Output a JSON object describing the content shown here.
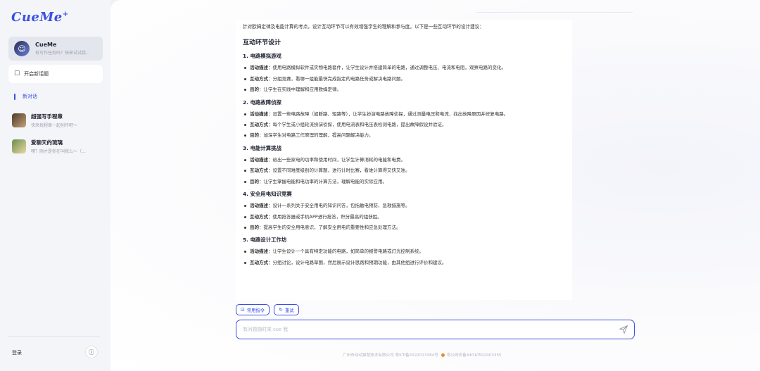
{
  "app": {
    "logo": "CueMe",
    "logo_mark": "+"
  },
  "sidebar": {
    "agent": {
      "name": "CueMe",
      "subtitle": "有写作任务吗？快来试试我..."
    },
    "new_topic_label": "开启新话题",
    "new_chat_label": "新对话",
    "conversations": [
      {
        "name": "超强写手程章",
        "subtitle": "快来找程章一起创作吧～"
      },
      {
        "name": "爱聊天的琉璃",
        "subtitle": "嘿？刚才是你在叫我么～（..."
      }
    ],
    "login_label": "登录",
    "info_icon": "ⓘ"
  },
  "answer": {
    "intro": "针对欧姆定律及电能计算的考点，设计互动环节可以有效增强学生的理解和参与度。以下是一些互动环节的设计建议：",
    "heading": "互动环节设计",
    "sections": [
      {
        "title": "1. 电路模拟游戏",
        "items": [
          {
            "label": "活动描述",
            "text": "：使用电路模拟软件或实物电路套件，让学生设计并搭建简单的电路，通过调整电压、电流和电阻，观察电路的变化。"
          },
          {
            "label": "互动方式",
            "text": "：分组竞赛，看哪一组能最快完成指定的电路任务或解决电路问题。"
          },
          {
            "label": "目的",
            "text": "：让学生在实践中理解和应用欧姆定律。"
          }
        ]
      },
      {
        "title": "2. 电路故障侦探",
        "items": [
          {
            "label": "活动描述",
            "text": "：设置一些电路故障（如断路、短路等），让学生扮演电路故障侦探，通过测量电压和电流，找出故障原因并修复电路。"
          },
          {
            "label": "互动方式",
            "text": "：每个学生或小组轮流扮演侦探，使用电流表和电压表检测电路，提出故障假设并验证。"
          },
          {
            "label": "目的",
            "text": "：加深学生对电路工作原理的理解，提高问题解决能力。"
          }
        ]
      },
      {
        "title": "3. 电能计算挑战",
        "items": [
          {
            "label": "活动描述",
            "text": "：给出一些家电的功率和使用时间，让学生计算消耗的电能和电费。"
          },
          {
            "label": "互动方式",
            "text": "：设置不同难度级别的计算题，进行计时比赛，看谁计算得又快又准。"
          },
          {
            "label": "目的",
            "text": "：让学生掌握电能和电功率的计算方法，理解电能的实际应用。"
          }
        ]
      },
      {
        "title": "4. 安全用电知识竞赛",
        "items": [
          {
            "label": "活动描述",
            "text": "：设计一系列关于安全用电的知识问答，包括触电预防、急救措施等。"
          },
          {
            "label": "互动方式",
            "text": "：使用抢答器或手机APP进行抢答，积分最高的组获胜。"
          },
          {
            "label": "目的",
            "text": "：提高学生的安全用电意识，了解安全用电的重要性和应急处理方法。"
          }
        ]
      },
      {
        "title": "5. 电路设计工作坊",
        "items": [
          {
            "label": "活动描述",
            "text": "：让学生设计一个具有特定功能的电路，如简单的报警电路或灯光控制系统。"
          },
          {
            "label": "互动方式",
            "text": "：分组讨论，设计电路草图，然后展示设计思路和预期功能，由其他组进行评价和建议。"
          }
        ]
      }
    ]
  },
  "chips": {
    "common_commands": "常用指令",
    "retry": "重试"
  },
  "input": {
    "placeholder": "有问题随时来 cue 我"
  },
  "footer": {
    "company": "广州市动动猫慧技术有限公司 粤ICP备2022013384号",
    "police": "粤公网安备44010502003355"
  }
}
